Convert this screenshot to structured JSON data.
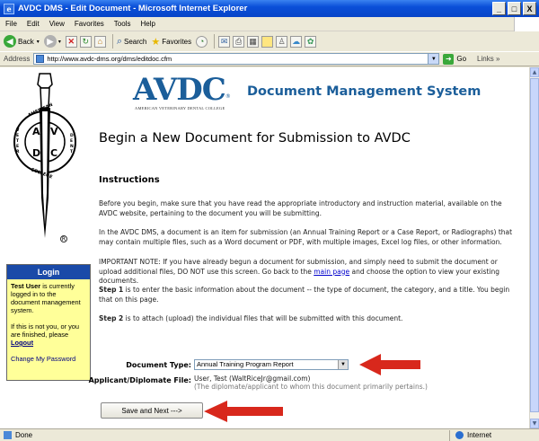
{
  "window": {
    "title": "AVDC DMS - Edit Document - Microsoft Internet Explorer",
    "minimize": "_",
    "maximize": "□",
    "close": "X"
  },
  "menu": [
    "File",
    "Edit",
    "View",
    "Favorites",
    "Tools",
    "Help"
  ],
  "toolbar": {
    "back": "Back",
    "search": "Search",
    "favorites": "Favorites"
  },
  "address": {
    "label": "Address",
    "url": "http://www.avdc-dms.org/dms/editdoc.cfm",
    "go": "Go",
    "links": "Links"
  },
  "sidebar": {
    "emblem_text": [
      "AMERICAN",
      "VETERINARY",
      "DENTAL",
      "COLLEGE",
      "AVDC"
    ],
    "registered": "R",
    "login": {
      "title": "Login",
      "user_name": "Test User",
      "logged_in_text": " is currently logged in to the document management system.",
      "not_you_text": "If this is not you, or you are finished, please",
      "logout": "Logout",
      "change_password": "Change My Password"
    }
  },
  "header": {
    "logo": "AVDC",
    "logo_sub": "American Veterinary Dental College",
    "logo_reg": "®",
    "system_title": "Document Management System"
  },
  "main": {
    "page_title": "Begin a New Document for Submission to AVDC",
    "instructions_title": "Instructions",
    "para1": "Before you begin, make sure that you have read the appropriate introductory and instruction material, available on the AVDC website, pertaining to the document you will be submitting.",
    "para2": "In the AVDC DMS, a document is an item for submission (an Annual Training Report or a Case Report, or Radiographs) that may contain multiple files, such as a Word document or PDF, with multiple images, Excel log files, or other information.",
    "para3_a": "IMPORTANT NOTE: If you have already begun a document for submission, and simply need to submit the document or upload additional files, DO NOT use this screen. Go back to the ",
    "para3_link": "main page",
    "para3_b": " and choose the option to view your existing documents.",
    "step1_bold": "Step 1",
    "step1_text": " is to enter the basic information about the document -- the type of document, the category, and a title. You begin that on this page.",
    "step2_bold": "Step 2",
    "step2_text": " is to attach (upload) the individual files that will be submitted with this document."
  },
  "form": {
    "doc_type_label": "Document Type:",
    "doc_type_value": "Annual Training Program Report",
    "applicant_label": "Applicant/Diplomate File:",
    "applicant_value": "User, Test (WaltRiceJr@gmail.com)",
    "applicant_note": "(The diplomate/applicant to whom this document primarily pertains.)",
    "submit_label": "Save and Next --->"
  },
  "status": {
    "text": "Done",
    "zone": "Internet"
  },
  "colors": {
    "accent": "#1b5e9a",
    "login_header": "#1a4aa8",
    "login_bg": "#ffff99",
    "arrow": "#d8281c"
  }
}
